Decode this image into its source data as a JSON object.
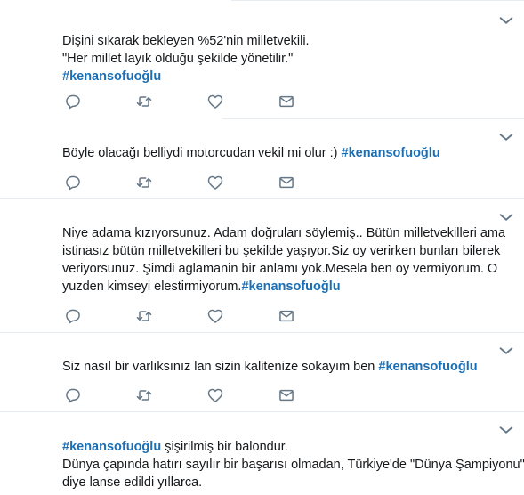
{
  "tweets": [
    {
      "lines": [
        {
          "text": "Dişini sıkarak bekleyen %52'nin milletvekili.",
          "tag": ""
        },
        {
          "text": "\"Her millet layık olduğu şekilde yönetilir.\"",
          "tag": ""
        },
        {
          "text": "",
          "tag": "#kenansofuoğlu"
        }
      ]
    },
    {
      "lines": [
        {
          "text": "Böyle olacağı belliydi motorcudan vekil mi olur :) ",
          "tag": "#kenansofuoğlu"
        }
      ]
    },
    {
      "lines": [
        {
          "text": "Niye adama kızıyorsunuz. Adam doğruları söylemiş.. Bütün milletvekilleri ama",
          "tag": ""
        },
        {
          "text": "istinasız bütün milletvekilleri bu şekilde yaşıyor.Siz oy verirken bunları bilerek",
          "tag": ""
        },
        {
          "text": "veriyorsunuz. Şimdi aglamanin bir anlamı yok.Mesela ben oy vermiyorum. O",
          "tag": ""
        },
        {
          "text": "yuzden kimseyi elestirmiyorum.",
          "tag": "#kenansofuoğlu"
        }
      ]
    },
    {
      "lines": [
        {
          "text": "Siz nasıl bir varlıksınız lan sizin kalitenize sokayım ben ",
          "tag": "#kenansofuoğlu"
        }
      ]
    },
    {
      "lines": [
        {
          "text": "",
          "tag": "#kenansofuoğlu",
          "after": " şişirilmiş bir balondur."
        },
        {
          "text": "Dünya çapında hatırı sayılır bir başarısı olmadan, Türkiye'de \"Dünya Şampiyonu\"",
          "tag": ""
        },
        {
          "text": "diye lanse edildi yıllarca.",
          "tag": ""
        }
      ]
    }
  ],
  "icons": [
    "reply-icon",
    "retweet-icon",
    "like-icon",
    "message-icon",
    "chevron-down-icon"
  ],
  "colors": {
    "text": "#14171a",
    "hashtag": "#1b6fb5",
    "icon": "#657786",
    "divider": "#e6ecf0"
  }
}
